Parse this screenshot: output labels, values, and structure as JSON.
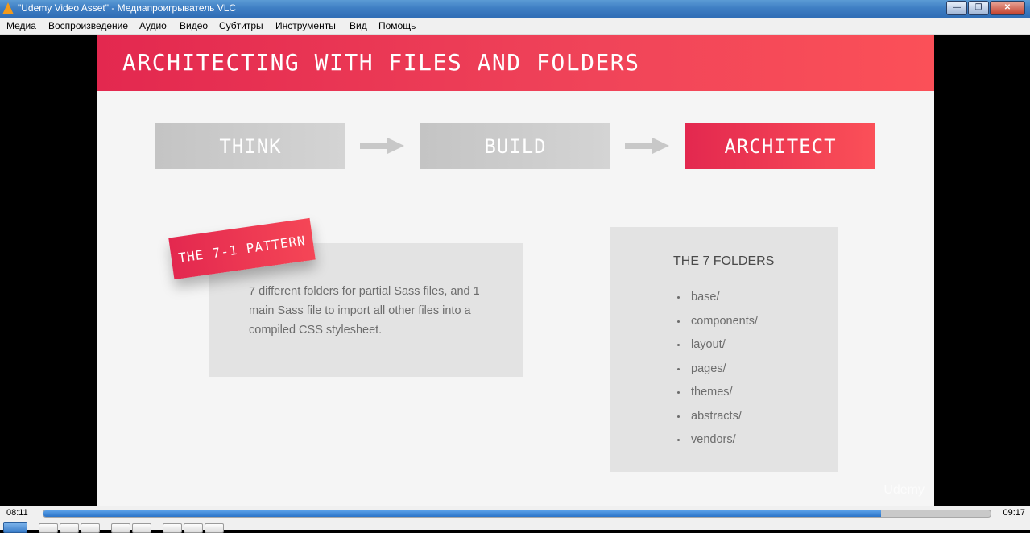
{
  "window": {
    "title": "\"Udemy Video Asset\" - Медиапроигрыватель VLC",
    "buttons": [
      "minimize-icon",
      "maximize-icon",
      "close-icon"
    ],
    "close_glyph": "✕"
  },
  "menu": {
    "items": [
      "Медиа",
      "Воспроизведение",
      "Аудио",
      "Видео",
      "Субтитры",
      "Инструменты",
      "Вид",
      "Помощь"
    ]
  },
  "slide": {
    "title": "ARCHITECTING WITH FILES AND FOLDERS",
    "steps": [
      "THINK",
      "BUILD",
      "ARCHITECT"
    ],
    "pattern_tag": "THE 7-1 PATTERN",
    "pattern_text": "7 different folders for partial Sass files, and 1 main Sass file to import all other files into a compiled CSS stylesheet.",
    "folders_title": "THE 7 FOLDERS",
    "folders": [
      "base/",
      "components/",
      "layout/",
      "pages/",
      "themes/",
      "abstracts/",
      "vendors/"
    ],
    "watermark": "Udemy",
    "colors": {
      "accent_start": "#e3284f",
      "accent_end": "#fb5058",
      "inactive_step": "#c8c8c8"
    }
  },
  "player": {
    "elapsed": "08:11",
    "total": "09:17",
    "progress": 0.884
  }
}
